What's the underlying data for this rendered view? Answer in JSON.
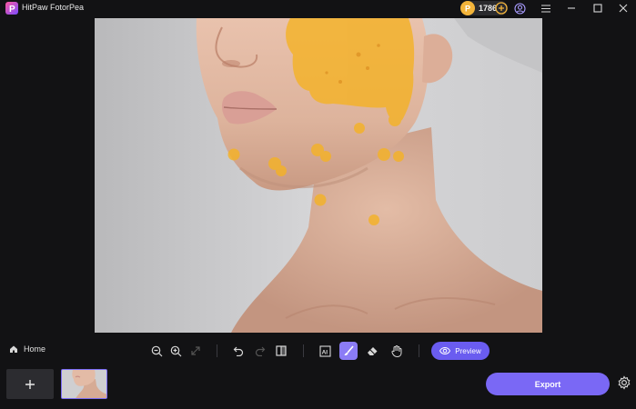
{
  "app": {
    "title": "HitPaw FotorPea",
    "credits": "1786"
  },
  "toolbar": {
    "home_label": "Home",
    "ai_label": "AI",
    "preview_label": "Preview"
  },
  "bottom": {
    "export_label": "Export"
  },
  "colors": {
    "accent": "#7a68f5",
    "brush_overlay": "#f4b227",
    "coin": "#f3b43a",
    "background": "#121214"
  },
  "icons": [
    "app-logo-icon",
    "coin-icon",
    "add-credits-icon",
    "account-icon",
    "menu-icon",
    "minimize-icon",
    "maximize-icon",
    "close-icon",
    "home-icon",
    "zoom-out-icon",
    "zoom-in-icon",
    "fit-screen-icon",
    "undo-icon",
    "redo-icon",
    "compare-icon",
    "ai-select-icon",
    "brush-icon",
    "eraser-icon",
    "hand-icon",
    "eye-icon",
    "plus-icon",
    "settings-icon"
  ]
}
